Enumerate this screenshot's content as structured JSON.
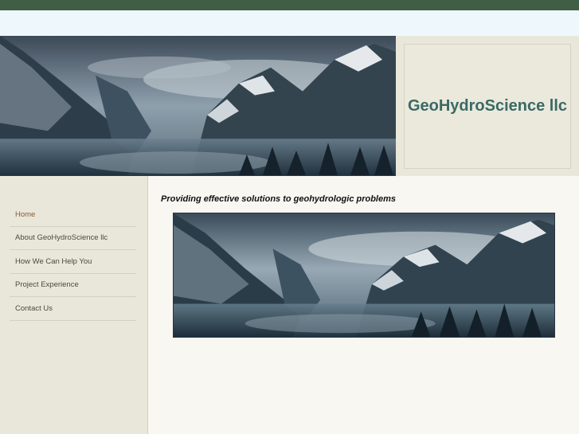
{
  "site": {
    "title": "GeoHydroScience llc"
  },
  "nav": {
    "items": [
      {
        "label": "Home",
        "active": true
      },
      {
        "label": "About GeoHydroScience llc",
        "active": false
      },
      {
        "label": "How We Can Help You",
        "active": false
      },
      {
        "label": "Project Experience",
        "active": false
      },
      {
        "label": "Contact Us",
        "active": false
      }
    ]
  },
  "main": {
    "tagline": "Providing effective solutions to geohydrologic problems"
  },
  "colors": {
    "topbar": "#3f5e44",
    "title": "#3a6a66",
    "sidebar": "#e9e7da",
    "active_nav": "#8a5a3a"
  }
}
